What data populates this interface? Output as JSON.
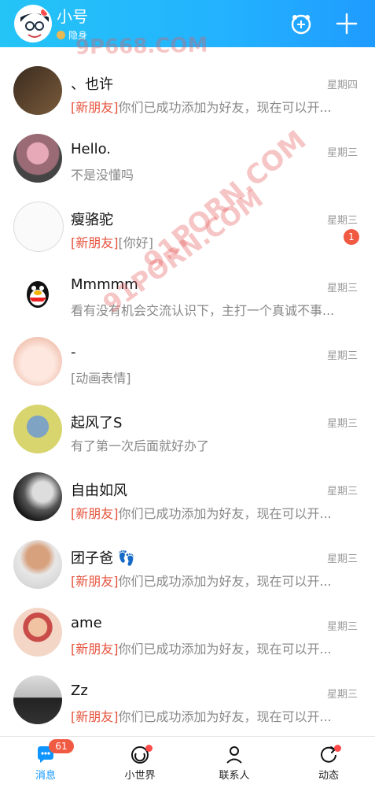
{
  "header": {
    "title": "小号",
    "status": "隐身",
    "icons": [
      "avatar-icon",
      "game-icon",
      "plus-icon"
    ]
  },
  "watermarks": [
    "9P668.COM",
    "91PORN.COM",
    "91PORN.COM"
  ],
  "messages": [
    {
      "name": "、也许",
      "time": "星期四",
      "tag": "[新朋友]",
      "text": "你们已成功添加为好友，现在可以开..."
    },
    {
      "name": "Hello.",
      "time": "星期三",
      "tag": "",
      "text": "不是没懂吗"
    },
    {
      "name": "瘦骆驼",
      "time": "星期三",
      "tag": "[新朋友]",
      "text": "[你好]",
      "badge": "1"
    },
    {
      "name": "Mmmmm",
      "time": "星期三",
      "tag": "",
      "text": "看有没有机会交流认识下，主打一个真诚不事..."
    },
    {
      "name": "-",
      "time": "星期三",
      "tag": "",
      "text": "[动画表情]"
    },
    {
      "name": "起风了S",
      "time": "星期三",
      "tag": "",
      "text": "有了第一次后面就好办了"
    },
    {
      "name": "自由如风",
      "time": "星期三",
      "tag": "[新朋友]",
      "text": "你们已成功添加为好友，现在可以开..."
    },
    {
      "name": "团子爸 👣",
      "time": "星期三",
      "tag": "[新朋友]",
      "text": "你们已成功添加为好友，现在可以开..."
    },
    {
      "name": "ame",
      "time": "星期三",
      "tag": "[新朋友]",
      "text": "你们已成功添加为好友，现在可以开..."
    },
    {
      "name": "Zz",
      "time": "星期三",
      "tag": "[新朋友]",
      "text": "你们已成功添加为好友，现在可以开..."
    }
  ],
  "tabs": [
    {
      "label": "消息",
      "badge": "61",
      "icon": "message-icon"
    },
    {
      "label": "小世界",
      "icon": "world-icon"
    },
    {
      "label": "联系人",
      "icon": "contacts-icon"
    },
    {
      "label": "动态",
      "icon": "activity-icon"
    }
  ],
  "colors": {
    "header_start": "#24c4f6",
    "header_end": "#1f9bff",
    "accent_tag": "#e5533d",
    "badge": "#f15a42",
    "active_tab": "#0f95ff"
  }
}
